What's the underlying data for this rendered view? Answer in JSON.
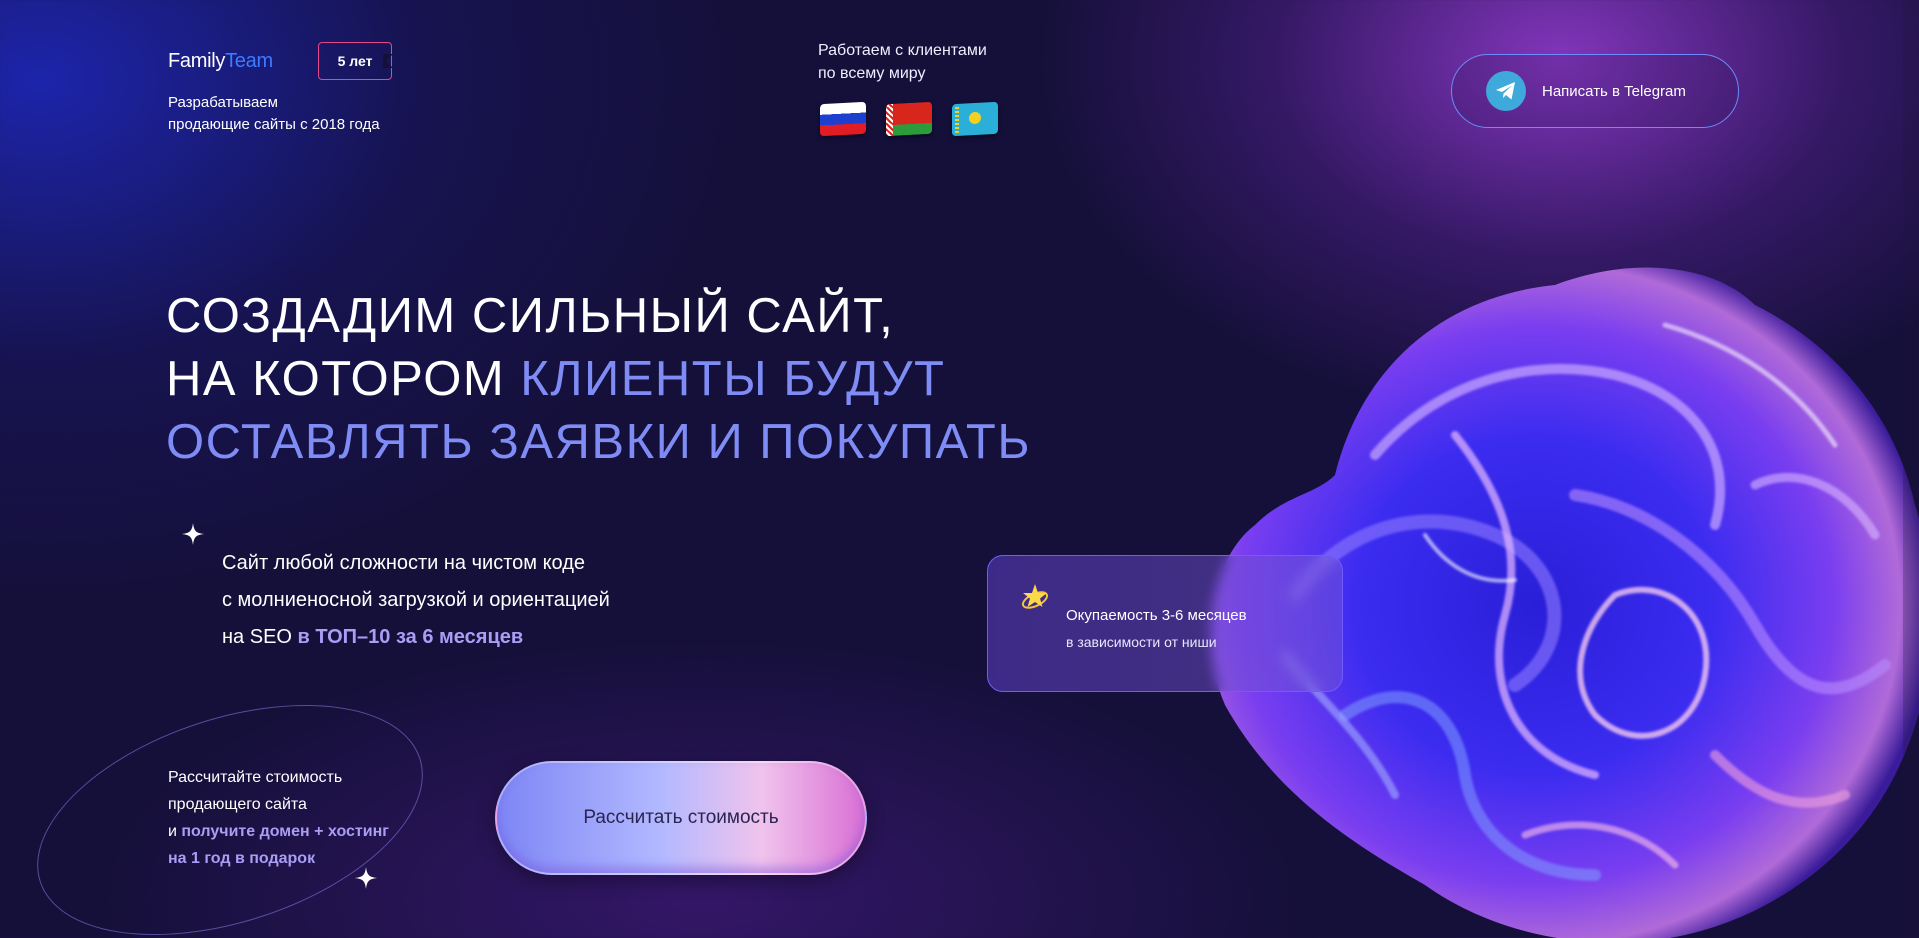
{
  "header": {
    "logo": {
      "part1": "Family",
      "part2": "Team"
    },
    "badge": "5 лет",
    "tagline_line1": "Разрабатываем",
    "tagline_line2": "продающие сайты с 2018 года",
    "world_line1": "Работаем с клиентами",
    "world_line2": "по всему миру",
    "flags": [
      "russia-flag-icon",
      "belarus-flag-icon",
      "kazakhstan-flag-icon"
    ],
    "telegram_button": "Написать в Telegram"
  },
  "hero": {
    "headline_line1": "СОЗДАДИМ СИЛЬНЫЙ САЙТ,",
    "headline_line2_part1": "НА КОТОРОМ ",
    "headline_line2_part2": "КЛИЕНТЫ БУДУТ",
    "headline_line3": "ОСТАВЛЯТЬ ЗАЯВКИ И ПОКУПАТЬ",
    "desc_line1": "Сайт любой сложности на чистом коде",
    "desc_line2": "с молниеносной загрузкой и ориентацией",
    "desc_line3_part1": "на SEO ",
    "desc_line3_part2": "в ТОП–10 за 6 месяцев"
  },
  "card": {
    "line1": "Окупаемость 3-6 месяцев",
    "line2": "в зависимости от ниши"
  },
  "promo": {
    "line1": "Рассчитайте стоимость",
    "line2": "продающего сайта",
    "line3_part1": "и ",
    "line3_part2": "получите домен + хостинг",
    "line4": "на 1 год в подарок"
  },
  "cta": {
    "label": "Рассчитать стоимость"
  },
  "colors": {
    "background": "#15103a",
    "accent_blue": "#3d7bff",
    "headline_accent": "#7f8cf5",
    "text_accent": "#a99df5",
    "badge_border": "#e4458b",
    "telegram": "#3fa9dc"
  }
}
